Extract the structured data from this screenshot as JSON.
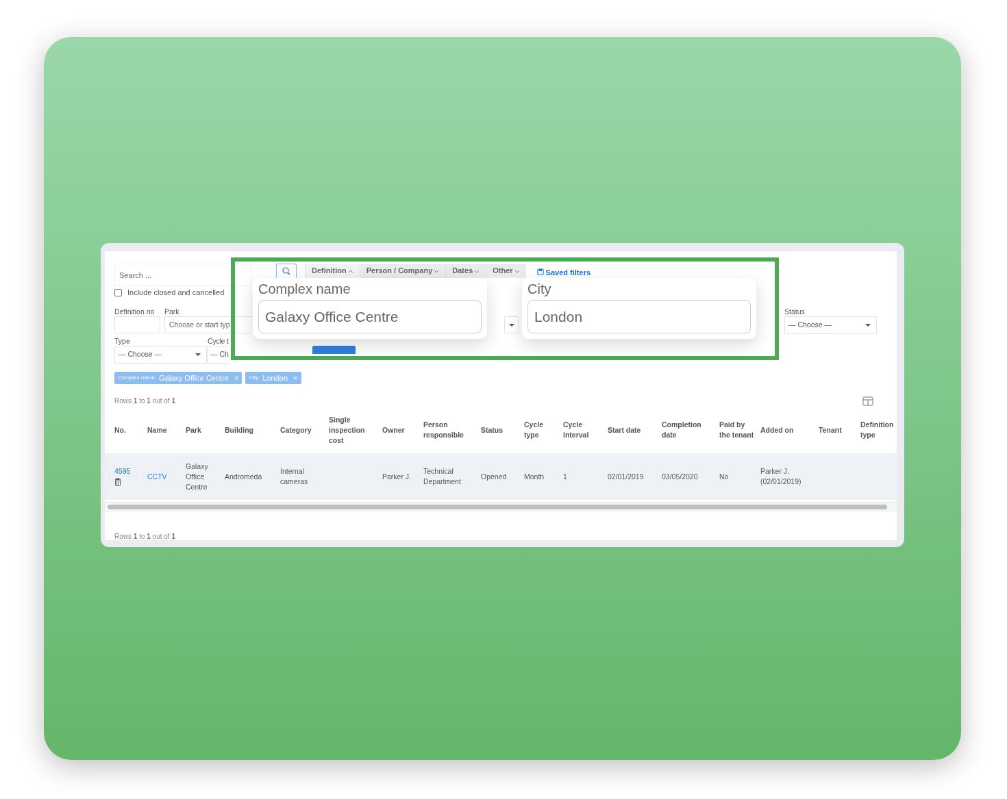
{
  "search": {
    "placeholder": "Search ..."
  },
  "filter_tabs": [
    {
      "label": "Definition",
      "expanded": true
    },
    {
      "label": "Person / Company",
      "expanded": false
    },
    {
      "label": "Dates",
      "expanded": false
    },
    {
      "label": "Other",
      "expanded": false
    }
  ],
  "saved_filters": "Saved filters",
  "include_closed": {
    "label": "Include closed and cancelled",
    "checked": false
  },
  "definition_no": {
    "label": "Definition no"
  },
  "park": {
    "label": "Park",
    "placeholder": "Choose or start typ"
  },
  "status": {
    "label": "Status",
    "value": "— Choose —"
  },
  "type": {
    "label": "Type",
    "value": "— Choose —"
  },
  "cycle_type": {
    "label": "Cycle t",
    "value": "— Ch"
  },
  "chips": [
    {
      "key": "Complex name:",
      "value": "Galaxy Office Centre",
      "remove": "×"
    },
    {
      "key": "City:",
      "value": "London",
      "remove": "×"
    }
  ],
  "rows_info_top": "Rows **1** to **1** out of **1**",
  "table": {
    "columns": [
      "No.",
      "Name",
      "Park",
      "Building",
      "Category",
      "Single inspection cost",
      "Owner",
      "Person responsible",
      "Status",
      "Cycle type",
      "Cycle interval",
      "Start date",
      "Completion date",
      "Paid by the tenant",
      "Added on",
      "Tenant",
      "Definition type"
    ],
    "rows": [
      {
        "cells": [
          {
            "text": "4595",
            "kind": "link"
          },
          {
            "text": "CCTV",
            "kind": "link"
          },
          {
            "text": "Galaxy Office Centre",
            "kind": "text"
          },
          {
            "text": "Andromeda",
            "kind": "text"
          },
          {
            "text": "Internal cameras",
            "kind": "text"
          },
          null,
          {
            "text": "Parker J.",
            "kind": "text"
          },
          {
            "text": "Technical Department",
            "kind": "text"
          },
          {
            "text": "Opened",
            "kind": "text"
          },
          {
            "text": "Month",
            "kind": "text"
          },
          {
            "text": "1",
            "kind": "text"
          },
          {
            "text": "02/01/2019",
            "kind": "text"
          },
          {
            "text": "03/05/2020",
            "kind": "text"
          },
          {
            "text": "No",
            "kind": "text"
          },
          {
            "text": "Parker J. (02/01/2019)",
            "kind": "text"
          },
          null,
          null
        ]
      }
    ]
  },
  "rows_info_bottom": "Rows **1** to **1** out of **1**",
  "popups": [
    {
      "label": "Complex name",
      "value": "Galaxy Office Centre"
    },
    {
      "label": "City",
      "value": "London"
    }
  ]
}
